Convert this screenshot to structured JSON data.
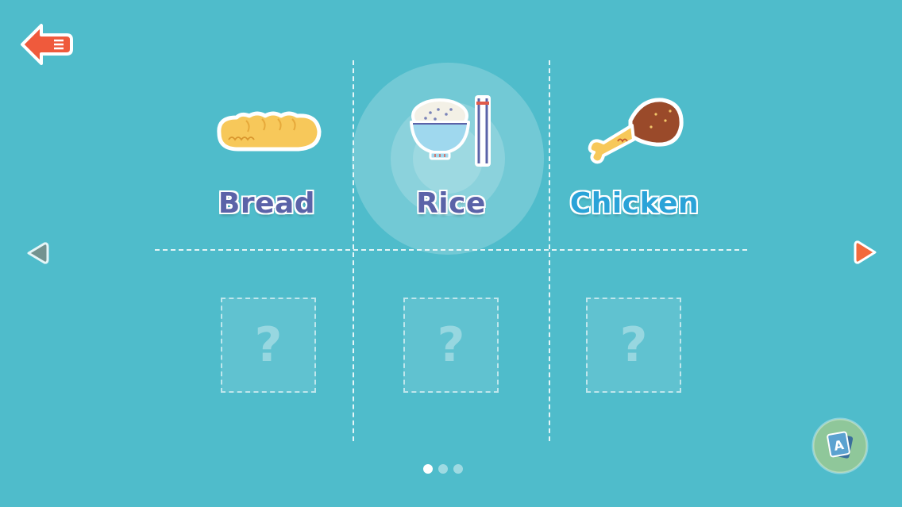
{
  "back_button": {
    "icon": "back-arrow-icon",
    "color": "#ef5a3c"
  },
  "items": [
    {
      "label": "Bread",
      "icon": "bread-icon",
      "color": "#5b63a8"
    },
    {
      "label": "Rice",
      "icon": "rice-bowl-icon",
      "color": "#5b63a8",
      "selected": true
    },
    {
      "label": "Chicken",
      "icon": "chicken-leg-icon",
      "color": "#2aa3d8"
    }
  ],
  "locked_slots": [
    {
      "symbol": "?"
    },
    {
      "symbol": "?"
    },
    {
      "symbol": "?"
    }
  ],
  "navigation": {
    "prev_icon": "triangle-left-icon",
    "next_icon": "triangle-right-icon",
    "next_color": "#f26a3c"
  },
  "pagination": {
    "current_page": 1,
    "total_pages": 3
  },
  "card_button": {
    "icon": "letter-card-icon",
    "letter": "A"
  }
}
